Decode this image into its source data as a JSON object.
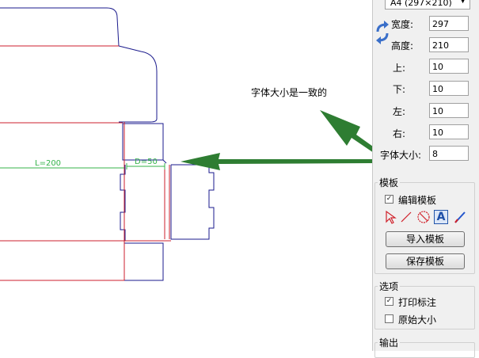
{
  "canvas": {
    "annotation": "字体大小是一致的",
    "dim_length": "L=200",
    "dim_depth": "D=50"
  },
  "panel": {
    "paper_select": "A4 (297×210)",
    "fields": [
      {
        "label": "宽度:",
        "value": "297"
      },
      {
        "label": "高度:",
        "value": "210"
      },
      {
        "label": "上:",
        "value": "10"
      },
      {
        "label": "下:",
        "value": "10"
      },
      {
        "label": "左:",
        "value": "10"
      },
      {
        "label": "右:",
        "value": "10"
      },
      {
        "label": "字体大小:",
        "value": "8"
      }
    ],
    "template_group": {
      "title": "模板",
      "edit_template": {
        "label": "编辑模板",
        "checked": true
      },
      "tools": [
        "select-arrow-icon",
        "line-icon",
        "circle-no-icon",
        "text-a-icon",
        "pen-icon"
      ],
      "import_button": "导入模板",
      "save_button": "保存模板"
    },
    "options_group": {
      "title": "选项",
      "print_annotation": {
        "label": "打印标注",
        "checked": true
      },
      "original_size": {
        "label": "原始大小",
        "checked": false
      }
    },
    "output_group": {
      "title": "输出"
    }
  },
  "colors": {
    "outline": "#1a1a8c",
    "fold": "#cc1f2d",
    "dimension": "#34b34a",
    "arrow": "#2e7d32"
  }
}
